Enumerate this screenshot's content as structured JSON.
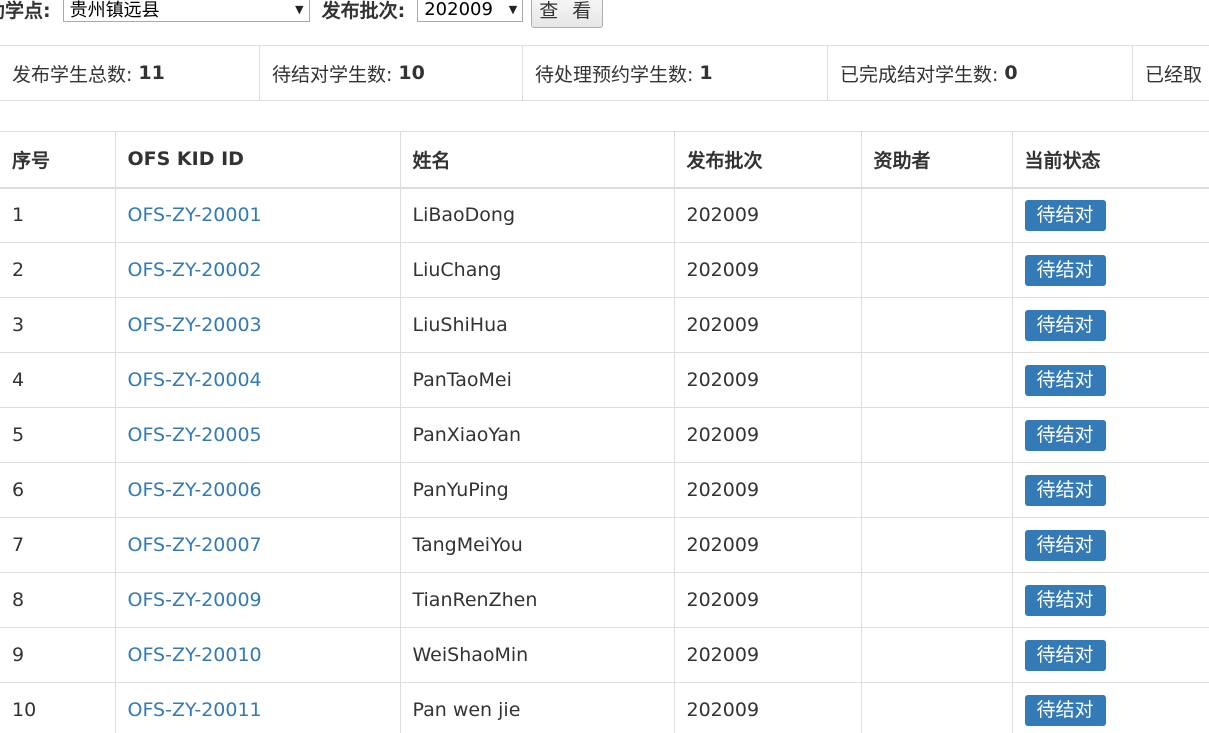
{
  "filters": {
    "site_label": "助学点:",
    "site_value": "贵州镇远县",
    "batch_label": "发布批次:",
    "batch_value": "202009",
    "view_button": "查 看"
  },
  "stats": [
    {
      "label": "发布学生总数:",
      "value": "11"
    },
    {
      "label": "待结对学生数:",
      "value": "10"
    },
    {
      "label": "待处理预约学生数:",
      "value": "1"
    },
    {
      "label": "已完成结对学生数:",
      "value": "0"
    },
    {
      "label": "已经取",
      "value": ""
    }
  ],
  "table": {
    "headers": [
      "序号",
      "OFS KID ID",
      "姓名",
      "发布批次",
      "资助者",
      "当前状态"
    ],
    "rows": [
      {
        "index": "1",
        "kid_id": "OFS-ZY-20001",
        "name": "LiBaoDong",
        "batch": "202009",
        "sponsor": "",
        "status": "待结对"
      },
      {
        "index": "2",
        "kid_id": "OFS-ZY-20002",
        "name": "LiuChang",
        "batch": "202009",
        "sponsor": "",
        "status": "待结对"
      },
      {
        "index": "3",
        "kid_id": "OFS-ZY-20003",
        "name": "LiuShiHua",
        "batch": "202009",
        "sponsor": "",
        "status": "待结对"
      },
      {
        "index": "4",
        "kid_id": "OFS-ZY-20004",
        "name": "PanTaoMei",
        "batch": "202009",
        "sponsor": "",
        "status": "待结对"
      },
      {
        "index": "5",
        "kid_id": "OFS-ZY-20005",
        "name": "PanXiaoYan",
        "batch": "202009",
        "sponsor": "",
        "status": "待结对"
      },
      {
        "index": "6",
        "kid_id": "OFS-ZY-20006",
        "name": "PanYuPing",
        "batch": "202009",
        "sponsor": "",
        "status": "待结对"
      },
      {
        "index": "7",
        "kid_id": "OFS-ZY-20007",
        "name": "TangMeiYou",
        "batch": "202009",
        "sponsor": "",
        "status": "待结对"
      },
      {
        "index": "8",
        "kid_id": "OFS-ZY-20009",
        "name": "TianRenZhen",
        "batch": "202009",
        "sponsor": "",
        "status": "待结对"
      },
      {
        "index": "9",
        "kid_id": "OFS-ZY-20010",
        "name": "WeiShaoMin",
        "batch": "202009",
        "sponsor": "",
        "status": "待结对"
      },
      {
        "index": "10",
        "kid_id": "OFS-ZY-20011",
        "name": "Pan wen jie",
        "batch": "202009",
        "sponsor": "",
        "status": "待结对"
      }
    ]
  }
}
